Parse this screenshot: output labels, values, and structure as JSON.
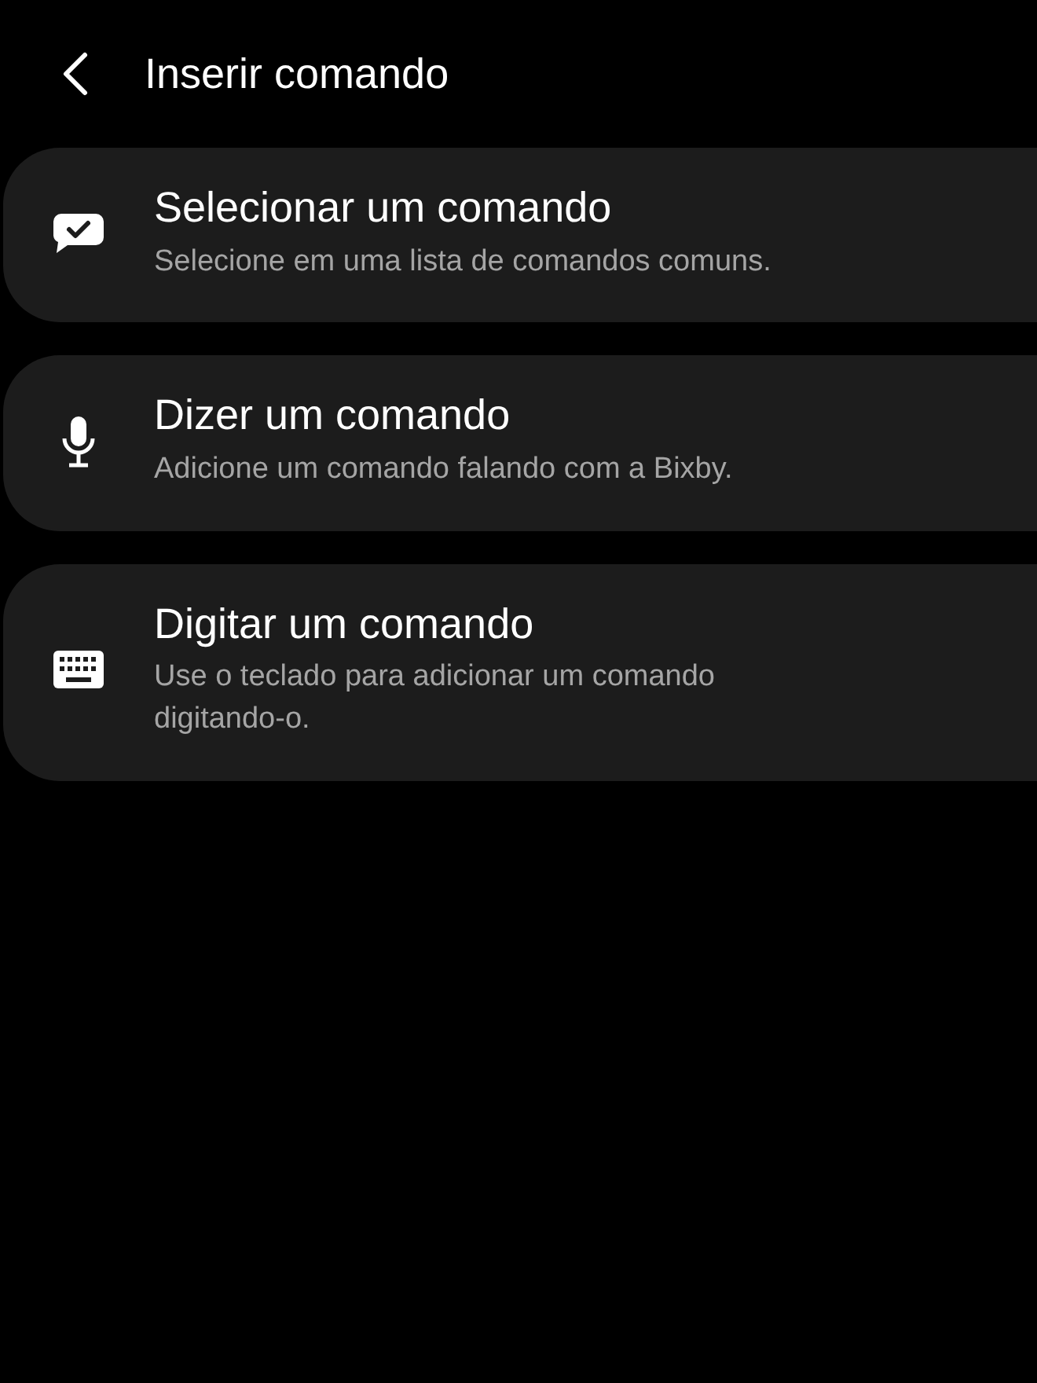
{
  "header": {
    "title": "Inserir comando"
  },
  "options": [
    {
      "kind": "chat",
      "title": "Selecionar um comando",
      "subtitle": "Selecione em uma lista de comandos comuns."
    },
    {
      "kind": "mic",
      "title": "Dizer um comando",
      "subtitle": "Adicione um comando falando com a Bixby."
    },
    {
      "kind": "keyboard",
      "title": "Digitar um comando",
      "subtitle": "Use o teclado para adicionar um comando digitando-o."
    }
  ]
}
